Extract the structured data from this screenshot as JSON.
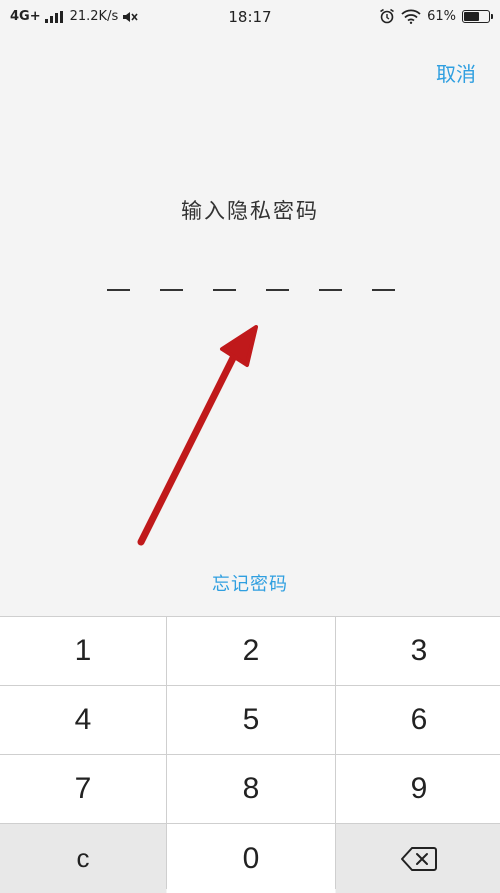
{
  "status_bar": {
    "network": "4G+",
    "speed": "21.2K/s",
    "time": "18:17",
    "battery_percent_text": "61%",
    "battery_level": 0.61,
    "icons": [
      "signal-bars-icon",
      "mute-icon",
      "alarm-clock-icon",
      "wifi-icon",
      "battery-icon"
    ]
  },
  "header": {
    "cancel_label": "取消"
  },
  "prompt": {
    "title": "输入隐私密码",
    "pin_length": 6
  },
  "forgot_label": "忘记密码",
  "keypad": {
    "keys": [
      "1",
      "2",
      "3",
      "4",
      "5",
      "6",
      "7",
      "8",
      "9",
      "c",
      "0"
    ],
    "backspace_icon": "backspace-icon"
  },
  "annotation_color": "#c0191b",
  "accent_color": "#2f9fe0"
}
